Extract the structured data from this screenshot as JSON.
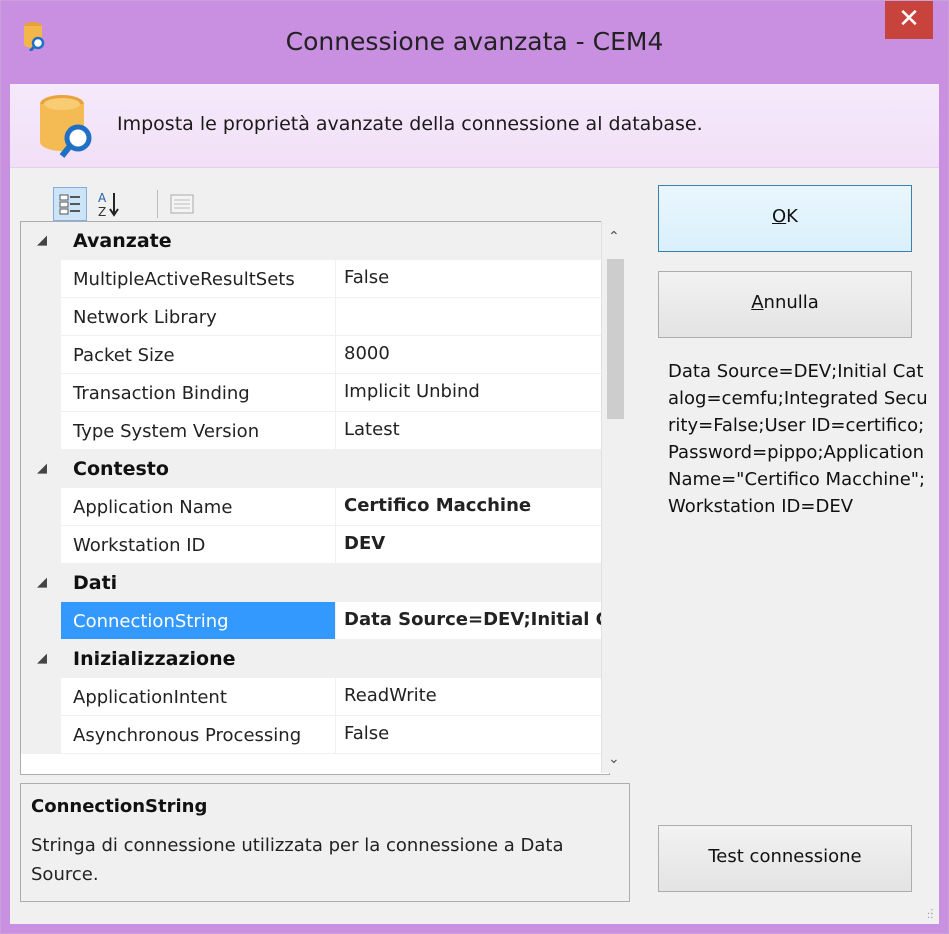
{
  "window": {
    "title": "Connessione avanzata - CEM4",
    "close_glyph": "✕",
    "icon": "database-search-icon"
  },
  "banner": {
    "icon": "database-search-icon",
    "text": "Imposta le proprietà avanzate della connessione al database."
  },
  "toolbar": {
    "buttons": [
      "categorized-view-icon",
      "alphabetical-sort-icon",
      "property-pages-icon"
    ]
  },
  "grid": {
    "rows": [
      {
        "type": "category",
        "label": "Avanzate"
      },
      {
        "type": "property",
        "name": "MultipleActiveResultSets",
        "value": "False",
        "bold": false
      },
      {
        "type": "property",
        "name": "Network Library",
        "value": "",
        "bold": false
      },
      {
        "type": "property",
        "name": "Packet Size",
        "value": "8000",
        "bold": false
      },
      {
        "type": "property",
        "name": "Transaction Binding",
        "value": "Implicit Unbind",
        "bold": false
      },
      {
        "type": "property",
        "name": "Type System Version",
        "value": "Latest",
        "bold": false
      },
      {
        "type": "category",
        "label": "Contesto"
      },
      {
        "type": "property",
        "name": "Application Name",
        "value": "Certifico Macchine",
        "bold": true
      },
      {
        "type": "property",
        "name": "Workstation ID",
        "value": "DEV",
        "bold": true
      },
      {
        "type": "category",
        "label": "Dati"
      },
      {
        "type": "property",
        "name": "ConnectionString",
        "value": "Data Source=DEV;Initial Catalog=cemfu;Integrated Security=False;User ID=certifico;Password=pippo;Application Name=\"Certifico Macchine\";Workstation ID=DEV",
        "bold": true,
        "selected": true
      },
      {
        "type": "category",
        "label": "Inizializzazione"
      },
      {
        "type": "property",
        "name": "ApplicationIntent",
        "value": "ReadWrite",
        "bold": false
      },
      {
        "type": "property",
        "name": "Asynchronous Processing",
        "value": "False",
        "bold": false
      }
    ]
  },
  "description": {
    "title": "ConnectionString",
    "text": "Stringa di connessione utilizzata per la connessione a Data Source."
  },
  "buttons": {
    "ok": "OK",
    "cancel": "Annulla",
    "test": "Test connessione"
  },
  "connection_preview": "Data Source=DEV;Initial Catalog=cemfu;Integrated Security=False;User ID=certifico;Password=pippo;Application Name=\"Certifico Macchine\";Workstation ID=DEV",
  "colors": {
    "title_bar": "#c98fe0",
    "banner": "#f3e4f9",
    "close_button": "#c8433b",
    "selection": "#3399ff"
  }
}
